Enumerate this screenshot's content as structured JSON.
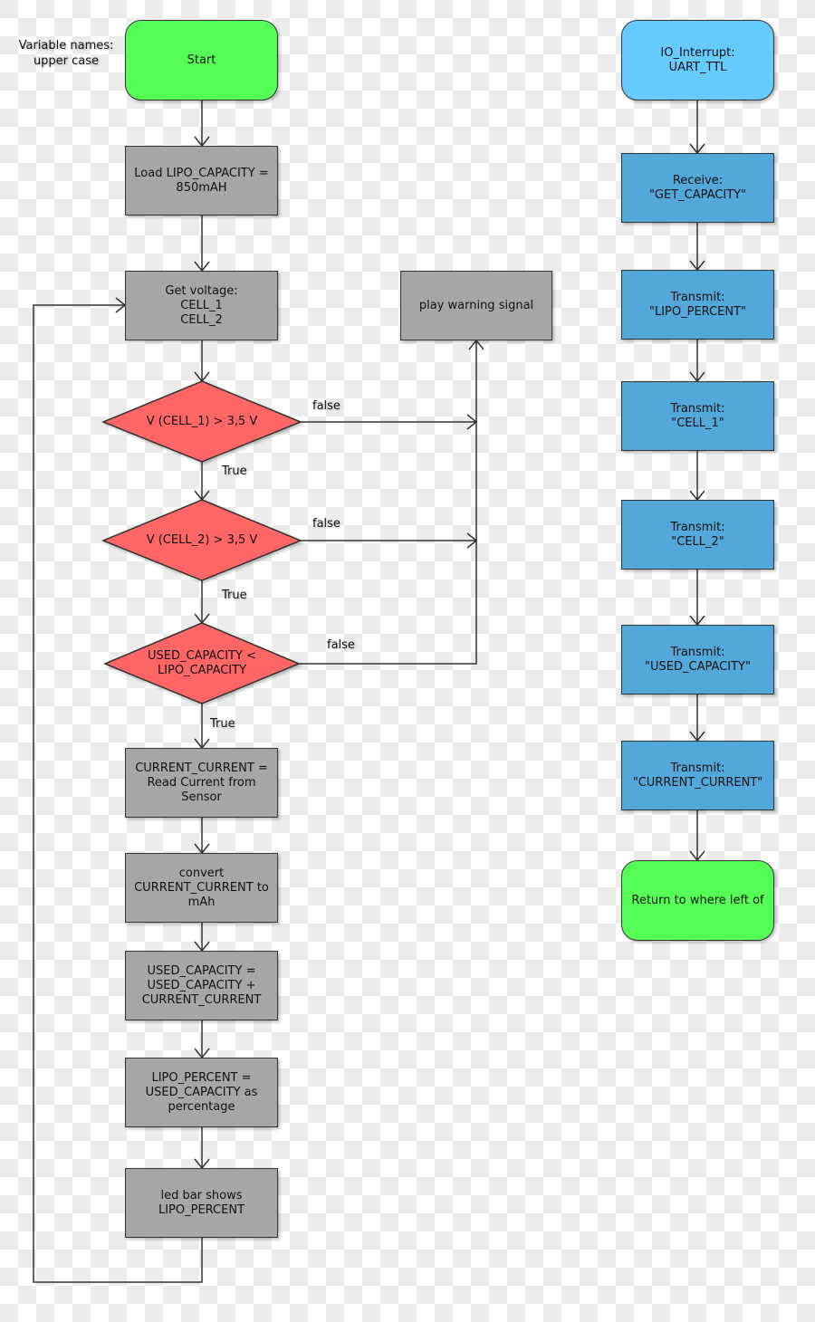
{
  "note": "Variable names:\nupper case",
  "main_flow": {
    "start": "Start",
    "load_capacity": "Load LIPO_CAPACITY =\n850mAH",
    "get_voltage": "Get voltage:\nCELL_1\nCELL_2",
    "decision_cell1": "V (CELL_1) > 3,5 V",
    "decision_cell2": "V (CELL_2) > 3,5 V",
    "decision_capacity": "USED_CAPACITY <\nLIPO_CAPACITY",
    "read_current": "CURRENT_CURRENT =\nRead Current from\nSensor",
    "convert_current": "convert\nCURRENT_CURRENT to\nmAh",
    "update_used": "USED_CAPACITY =\nUSED_CAPACITY +\nCURRENT_CURRENT",
    "compute_percent": "LIPO_PERCENT =\nUSED_CAPACITY as\npercentage",
    "led_bar": "led bar shows\nLIPO_PERCENT",
    "warning": "play warning signal"
  },
  "edge_labels": {
    "false_1": "false",
    "false_2": "false",
    "false_3": "false",
    "true_1": "True",
    "true_2": "True",
    "true_3": "True"
  },
  "interrupt_flow": {
    "interrupt": "IO_Interrupt:\nUART_TTL",
    "receive": "Receive:\n\"GET_CAPACITY\"",
    "tx_percent": "Transmit:\n\"LIPO_PERCENT\"",
    "tx_cell1": "Transmit:\n\"CELL_1\"",
    "tx_cell2": "Transmit:\n\"CELL_2\"",
    "tx_used": "Transmit:\n\"USED_CAPACITY\"",
    "tx_current": "Transmit:\n\"CURRENT_CURRENT\"",
    "return": "Return to where left of"
  },
  "colors": {
    "terminal_green": "#55ff55",
    "terminal_blue": "#66ccff",
    "process_grey": "#a6a6a6",
    "io_blue": "#52a8d8",
    "decision_red": "#ff6666"
  }
}
